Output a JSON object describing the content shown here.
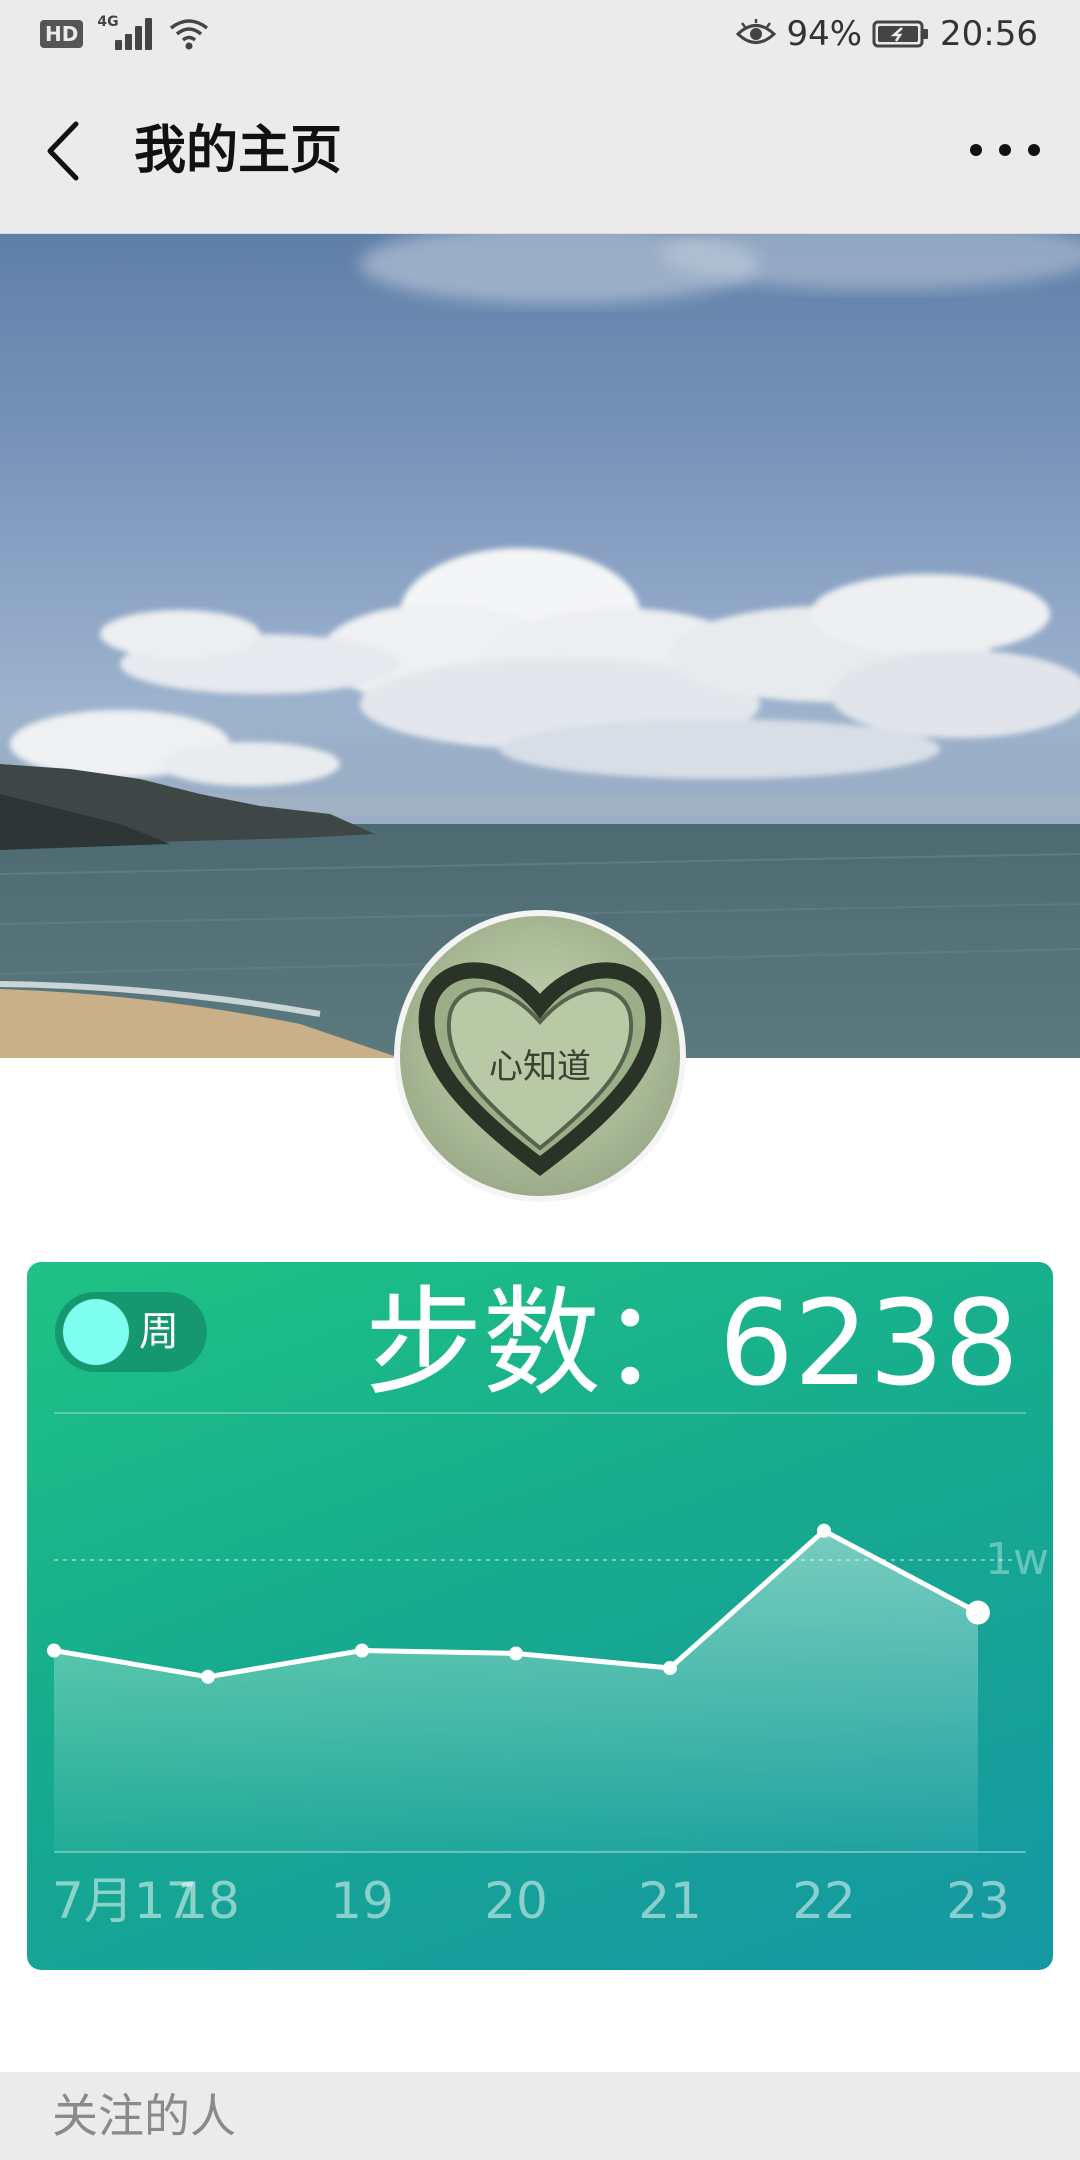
{
  "status_bar": {
    "hd": "HD",
    "network": "4G",
    "battery_percent": "94%",
    "time": "20:56",
    "icons": [
      "signal-icon",
      "wifi-icon",
      "eye-icon",
      "battery-icon"
    ]
  },
  "header": {
    "title": "我的主页",
    "back_icon": "chevron-left-icon",
    "more_icon": "more-dots-icon"
  },
  "profile": {
    "avatar_text": "心知道"
  },
  "steps_card": {
    "toggle_label": "周",
    "toggle_on": true,
    "steps_text": "步数：6238",
    "colors": {
      "card_start": "#1fc284",
      "card_end": "#1597a3",
      "knob": "#7ffff0"
    }
  },
  "chart_data": {
    "type": "area",
    "x": [
      "7月17",
      "18",
      "19",
      "20",
      "21",
      "22",
      "23"
    ],
    "values": [
      6900,
      6000,
      6900,
      6800,
      6300,
      11000,
      8200
    ],
    "reference_line": {
      "value": 10000,
      "label": "1w"
    },
    "ylim": [
      0,
      15000
    ],
    "grid": false
  },
  "sections": {
    "follow_label": "关注的人"
  }
}
